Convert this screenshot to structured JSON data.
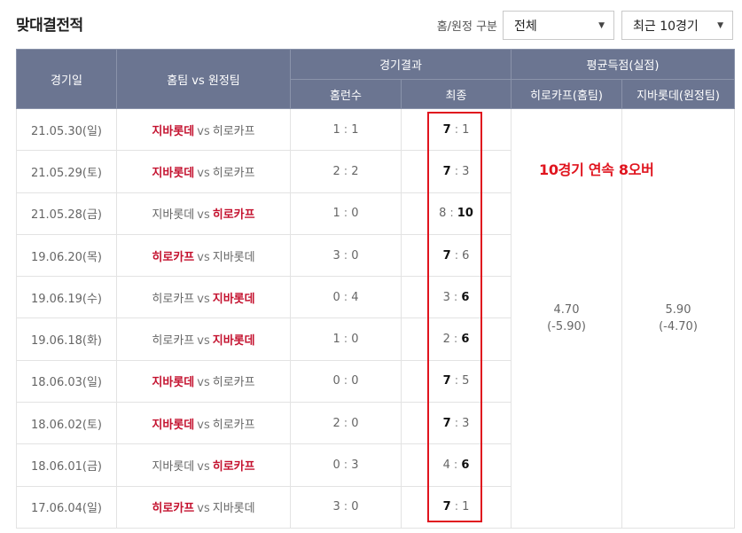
{
  "page": {
    "title": "맞대결전적"
  },
  "filters": {
    "label": "홈/원정 구분",
    "type_value": "전체",
    "recent_value": "최근 10경기"
  },
  "table": {
    "headers": {
      "date": "경기일",
      "match": "홈팀 vs 원정팀",
      "result_group": "경기결과",
      "avg_group": "평균득점(실점)",
      "homerun": "홈런수",
      "final": "최종",
      "avg_home": "히로카프(홈팀)",
      "avg_away": "지바롯데(원정팀)"
    },
    "vs_text": "vs",
    "rows": [
      {
        "date": "21.05.30(일)",
        "home": "지바롯데",
        "away": "히로카프",
        "winner": "home",
        "hr_home": "1",
        "hr_away": "1",
        "score_home": "7",
        "score_away": "1"
      },
      {
        "date": "21.05.29(토)",
        "home": "지바롯데",
        "away": "히로카프",
        "winner": "home",
        "hr_home": "2",
        "hr_away": "2",
        "score_home": "7",
        "score_away": "3"
      },
      {
        "date": "21.05.28(금)",
        "home": "지바롯데",
        "away": "히로카프",
        "winner": "away",
        "hr_home": "1",
        "hr_away": "0",
        "score_home": "8",
        "score_away": "10"
      },
      {
        "date": "19.06.20(목)",
        "home": "히로카프",
        "away": "지바롯데",
        "winner": "home",
        "hr_home": "3",
        "hr_away": "0",
        "score_home": "7",
        "score_away": "6"
      },
      {
        "date": "19.06.19(수)",
        "home": "히로카프",
        "away": "지바롯데",
        "winner": "away",
        "hr_home": "0",
        "hr_away": "4",
        "score_home": "3",
        "score_away": "6"
      },
      {
        "date": "19.06.18(화)",
        "home": "히로카프",
        "away": "지바롯데",
        "winner": "away",
        "hr_home": "1",
        "hr_away": "0",
        "score_home": "2",
        "score_away": "6"
      },
      {
        "date": "18.06.03(일)",
        "home": "지바롯데",
        "away": "히로카프",
        "winner": "home",
        "hr_home": "0",
        "hr_away": "0",
        "score_home": "7",
        "score_away": "5"
      },
      {
        "date": "18.06.02(토)",
        "home": "지바롯데",
        "away": "히로카프",
        "winner": "home",
        "hr_home": "2",
        "hr_away": "0",
        "score_home": "7",
        "score_away": "3"
      },
      {
        "date": "18.06.01(금)",
        "home": "지바롯데",
        "away": "히로카프",
        "winner": "away",
        "hr_home": "0",
        "hr_away": "3",
        "score_home": "4",
        "score_away": "6"
      },
      {
        "date": "17.06.04(일)",
        "home": "히로카프",
        "away": "지바롯데",
        "winner": "home",
        "hr_home": "3",
        "hr_away": "0",
        "score_home": "7",
        "score_away": "1"
      }
    ],
    "avg_home": {
      "value": "4.70",
      "sub": "(-5.90)"
    },
    "avg_away": {
      "value": "5.90",
      "sub": "(-4.70)"
    }
  },
  "annotation": {
    "text": "10경기 연속 8오버"
  },
  "colors": {
    "header_bg": "#6b7591",
    "winner_red": "#c4122f",
    "annotation_red": "#e0141e"
  }
}
